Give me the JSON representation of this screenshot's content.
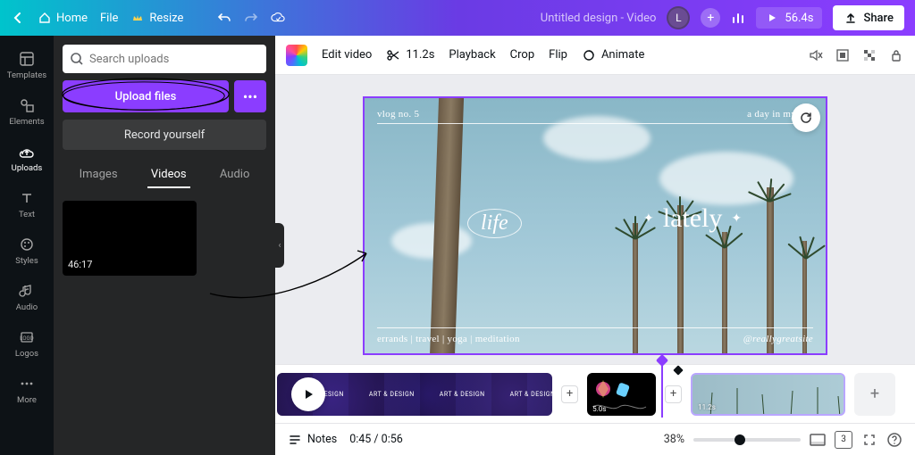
{
  "topbar": {
    "home": "Home",
    "file": "File",
    "resize": "Resize",
    "title": "Untitled design - Video",
    "avatar_initial": "L",
    "duration": "56.4s",
    "share": "Share"
  },
  "rail": [
    {
      "id": "templates",
      "label": "Templates"
    },
    {
      "id": "elements",
      "label": "Elements"
    },
    {
      "id": "uploads",
      "label": "Uploads"
    },
    {
      "id": "text",
      "label": "Text"
    },
    {
      "id": "styles",
      "label": "Styles"
    },
    {
      "id": "audio",
      "label": "Audio"
    },
    {
      "id": "logos",
      "label": "Logos"
    },
    {
      "id": "more",
      "label": "More"
    }
  ],
  "panel": {
    "search_placeholder": "Search uploads",
    "upload": "Upload files",
    "record": "Record yourself",
    "tabs": {
      "images": "Images",
      "videos": "Videos",
      "audio": "Audio"
    },
    "thumb_duration": "46:17"
  },
  "toolbar": {
    "edit_video": "Edit video",
    "trim_time": "11.2s",
    "playback": "Playback",
    "crop": "Crop",
    "flip": "Flip",
    "animate": "Animate"
  },
  "canvas": {
    "top_left": "vlog no. 5",
    "top_right": "a day in my life",
    "center_left": "life",
    "center_right": "lately",
    "bottom_left": "errands | travel | yoga | meditation",
    "bottom_right": "@reallygreatsite"
  },
  "timeline": {
    "clip1_label": "ART & DESIGN",
    "clip2_dur": "5.0s",
    "clip3_dur": "11.2s"
  },
  "bottom": {
    "notes": "Notes",
    "time": "0:45 / 0:56",
    "zoom": "38%",
    "pages": "3"
  }
}
